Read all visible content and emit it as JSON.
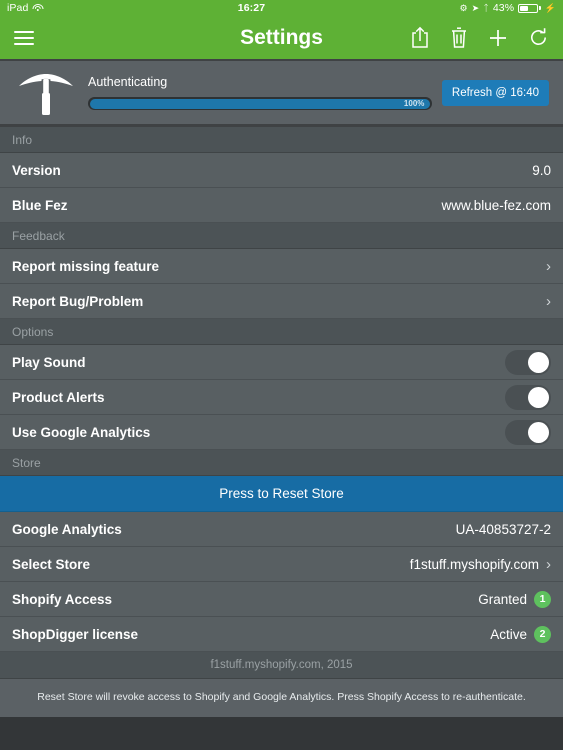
{
  "status_bar": {
    "device": "iPad",
    "wifi_icon": "wifi-icon",
    "time": "16:27",
    "location_icon": "location-arrow-icon",
    "bluetooth_icon": "bluetooth-icon",
    "rotation_lock_icon": "rotation-lock-icon",
    "battery_percent": "43%",
    "charging_icon": "charging-bolt-icon"
  },
  "navbar": {
    "menu_icon": "hamburger-menu-icon",
    "title": "Settings",
    "actions": [
      {
        "name": "share-icon"
      },
      {
        "name": "trash-icon"
      },
      {
        "name": "add-icon"
      },
      {
        "name": "refresh-icon"
      }
    ]
  },
  "auth_panel": {
    "app_icon": "pickaxe-icon",
    "status_label": "Authenticating",
    "progress_percent": "100%",
    "progress_value": 100,
    "refresh_button": "Refresh @ 16:40"
  },
  "sections": {
    "info": {
      "header": "Info",
      "rows": [
        {
          "label": "Version",
          "value": "9.0"
        },
        {
          "label": "Blue Fez",
          "value": "www.blue-fez.com"
        }
      ]
    },
    "feedback": {
      "header": "Feedback",
      "rows": [
        {
          "label": "Report missing feature"
        },
        {
          "label": "Report Bug/Problem"
        }
      ]
    },
    "options": {
      "header": "Options",
      "rows": [
        {
          "label": "Play Sound",
          "on": true
        },
        {
          "label": "Product Alerts",
          "on": true
        },
        {
          "label": "Use Google Analytics",
          "on": true
        }
      ]
    },
    "store": {
      "header": "Store",
      "reset_button": "Press to Reset Store",
      "rows": [
        {
          "label": "Google Analytics",
          "value": "UA-40853727-2"
        },
        {
          "label": "Select Store",
          "value": "f1stuff.myshopify.com"
        },
        {
          "label": "Shopify Access",
          "value": "Granted",
          "badge": "1"
        },
        {
          "label": "ShopDigger license",
          "value": "Active",
          "badge": "2"
        }
      ]
    }
  },
  "footer": {
    "store_line": "f1stuff.myshopify.com, 2015",
    "description": "Reset Store will revoke access to Shopify and Google Analytics. Press Shopify Access to re-authenticate."
  },
  "colors": {
    "brand_green": "#5eb135",
    "accent_blue": "#176ca4",
    "progress_blue": "#1e77ab",
    "badge_green": "#5ec15e",
    "row_bg": "#585f62",
    "section_bg": "#4c5356"
  }
}
